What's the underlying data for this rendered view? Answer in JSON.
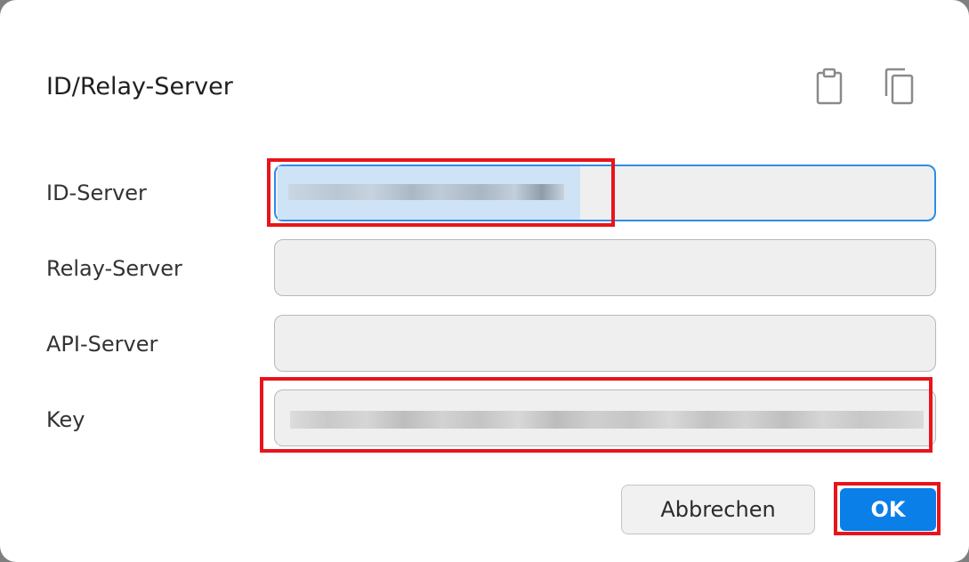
{
  "dialog": {
    "title": "ID/Relay-Server",
    "icons": {
      "paste": "clipboard-icon",
      "copy": "copy-icon"
    }
  },
  "fields": {
    "id_server": {
      "label": "ID-Server",
      "value": ""
    },
    "relay_server": {
      "label": "Relay-Server",
      "value": ""
    },
    "api_server": {
      "label": "API-Server",
      "value": ""
    },
    "key": {
      "label": "Key",
      "value": ""
    }
  },
  "buttons": {
    "cancel": "Abbrechen",
    "ok": "OK"
  },
  "colors": {
    "accent": "#0a7fe8",
    "focus_border": "#2f8de4",
    "highlight_box": "#e8141b",
    "selection": "#cfe3f6"
  }
}
